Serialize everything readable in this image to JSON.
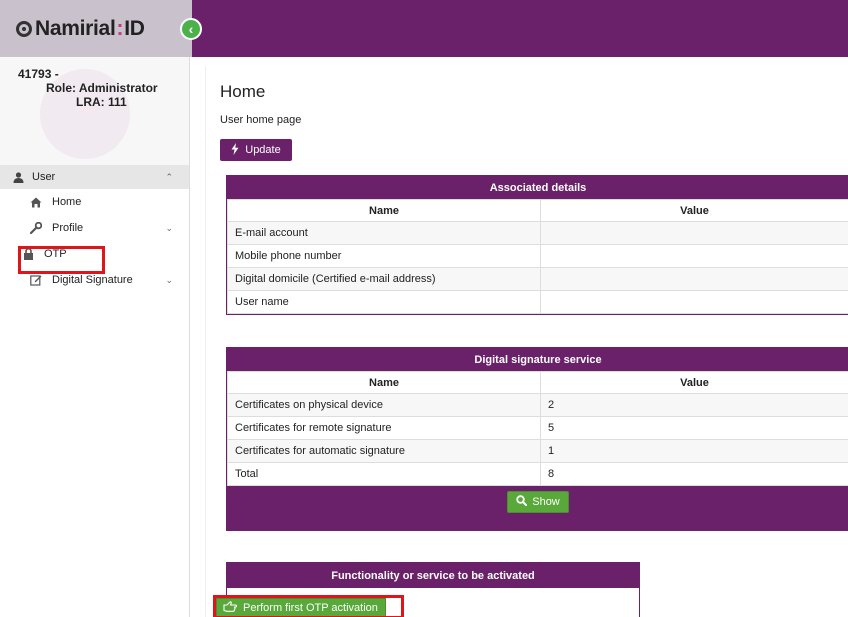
{
  "brand": {
    "logo_text": "Namirial",
    "logo_suffix": "ID",
    "logo_colon": ":"
  },
  "colors": {
    "primary": "#6a2169",
    "accent_green": "#58a83a",
    "highlight_red": "#e0151a"
  },
  "user": {
    "id_line": "41793 -",
    "role_line": "Role: Administrator",
    "lra_line": "LRA: 111"
  },
  "sidebar": {
    "section_label": "User",
    "items": [
      {
        "label": "Home",
        "icon": "home-icon"
      },
      {
        "label": "Profile",
        "icon": "wrench-icon"
      },
      {
        "label": "OTP",
        "icon": "lock-icon"
      },
      {
        "label": "Digital Signature",
        "icon": "edit-icon"
      }
    ]
  },
  "main": {
    "title": "Home",
    "subtitle": "User home page",
    "update_label": "Update",
    "associated": {
      "header": "Associated details",
      "columns": [
        "Name",
        "Value"
      ],
      "rows": [
        [
          "E-mail account",
          ""
        ],
        [
          "Mobile phone number",
          ""
        ],
        [
          "Digital domicile (Certified e-mail address)",
          ""
        ],
        [
          "User name",
          ""
        ]
      ]
    },
    "signature": {
      "header": "Digital signature service",
      "columns": [
        "Name",
        "Value"
      ],
      "rows": [
        [
          "Certificates on physical device",
          "2"
        ],
        [
          "Certificates for remote signature",
          "5"
        ],
        [
          "Certificates for automatic signature",
          "1"
        ],
        [
          "Total",
          "8"
        ]
      ],
      "show_label": "Show"
    },
    "functionality": {
      "header": "Functionality or service to be activated",
      "button_label": "Perform first OTP activation"
    }
  }
}
